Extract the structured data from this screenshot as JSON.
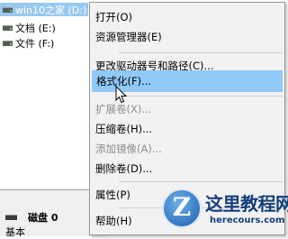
{
  "tree": {
    "items": [
      {
        "label": "win10之家 (D:)",
        "selected": true
      },
      {
        "label": "文档 (E:)",
        "selected": false
      },
      {
        "label": "文件 (F:)",
        "selected": false
      }
    ]
  },
  "disk": {
    "name": "磁盘 0",
    "type": "基本"
  },
  "menu": {
    "items": [
      {
        "label": "打开(O)",
        "enabled": true
      },
      {
        "label": "资源管理器(E)",
        "enabled": true
      },
      {
        "label": "更改驱动器号和路径(C)...",
        "enabled": true
      },
      {
        "label": "格式化(F)...",
        "enabled": true,
        "hover": true
      },
      {
        "label": "扩展卷(X)...",
        "enabled": false
      },
      {
        "label": "压缩卷(H)...",
        "enabled": true
      },
      {
        "label": "添加镜像(A)...",
        "enabled": false
      },
      {
        "label": "删除卷(D)...",
        "enabled": true
      },
      {
        "label": "属性(P)",
        "enabled": true
      },
      {
        "label": "帮助(H)",
        "enabled": true
      }
    ]
  },
  "watermark": {
    "brand": "这里教程网",
    "domain": "herecours.com",
    "badge_letter": "Z"
  },
  "colors": {
    "selection": "#99c9ef",
    "menu_hover": "#91c9f7",
    "menu_bg": "#f2f2f2",
    "disabled_text": "#8d8d8d",
    "logo_blue": "#153f7a"
  }
}
